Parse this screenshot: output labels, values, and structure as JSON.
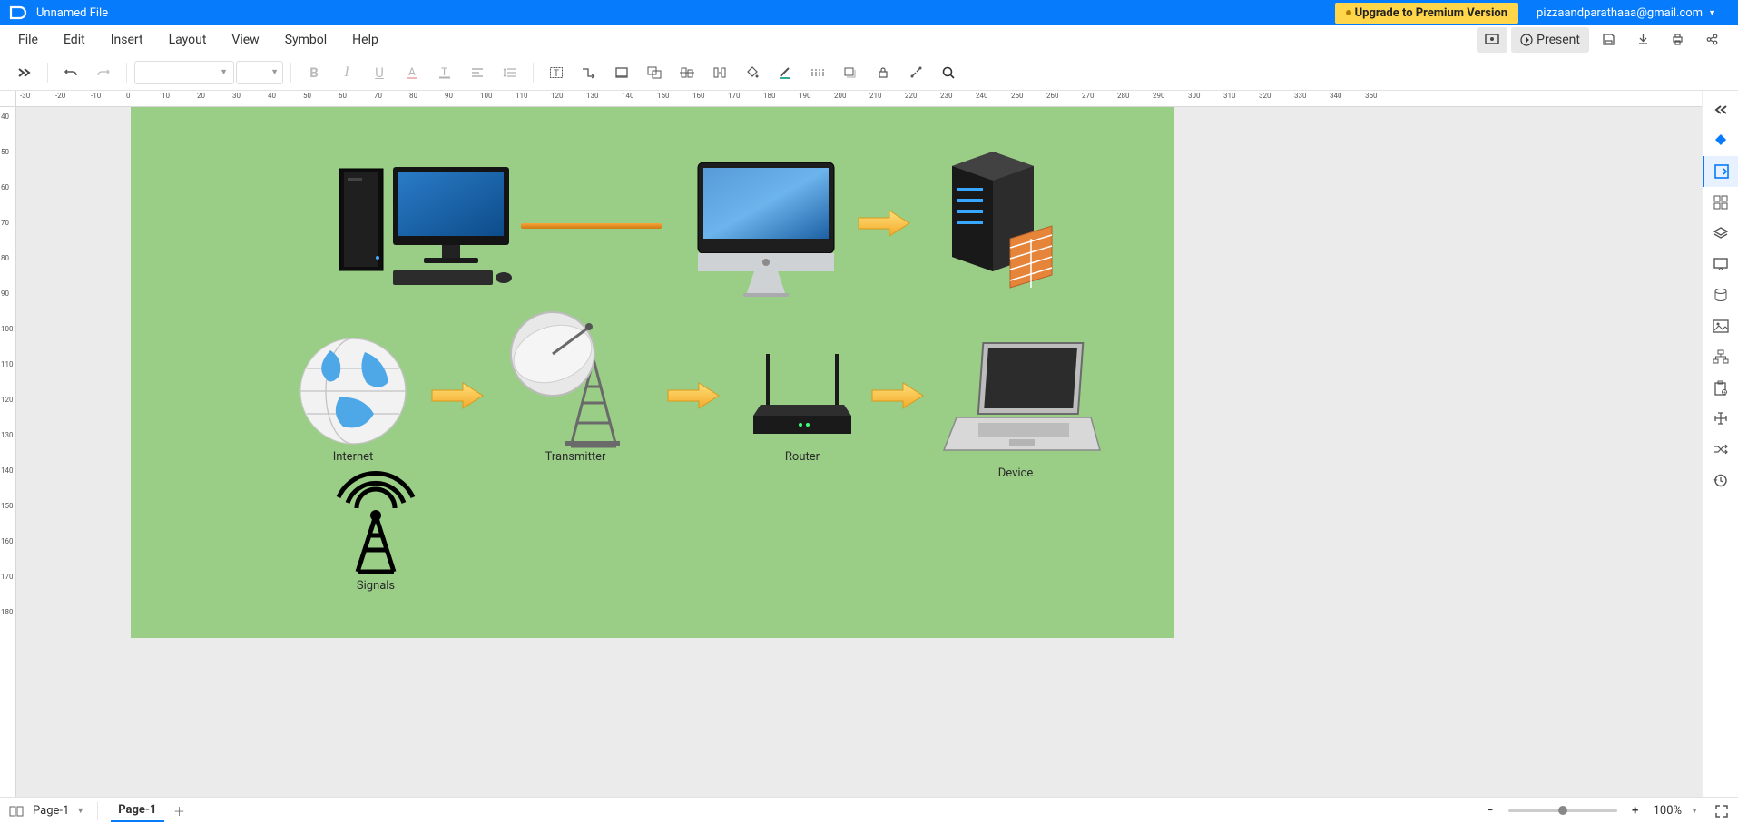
{
  "app": {
    "title": "Unnamed File",
    "upgrade_label": "Upgrade to Premium Version",
    "user_email": "pizzaandparathaaa@gmail.com"
  },
  "menu": {
    "items": [
      "File",
      "Edit",
      "Insert",
      "Layout",
      "View",
      "Symbol",
      "Help"
    ],
    "present_label": "Present"
  },
  "ruler_h": [
    "-30",
    "-20",
    "-10",
    "0",
    "10",
    "20",
    "30",
    "40",
    "50",
    "60",
    "70",
    "80",
    "90",
    "100",
    "110",
    "120",
    "130",
    "140",
    "150",
    "160",
    "170",
    "180",
    "190",
    "200",
    "210",
    "220",
    "230",
    "240",
    "250",
    "260",
    "270",
    "280",
    "290",
    "300",
    "310",
    "320",
    "330",
    "340",
    "350"
  ],
  "ruler_v": [
    "40",
    "50",
    "60",
    "70",
    "80",
    "90",
    "100",
    "110",
    "120",
    "130",
    "140",
    "150",
    "160",
    "170",
    "180"
  ],
  "diagram": {
    "labels": {
      "internet": "Internet",
      "transmitter": "Transmitter",
      "router": "Router",
      "device": "Device",
      "signals": "Signals"
    }
  },
  "status": {
    "page_selector": "Page-1",
    "active_tab": "Page-1",
    "zoom": "100%"
  }
}
